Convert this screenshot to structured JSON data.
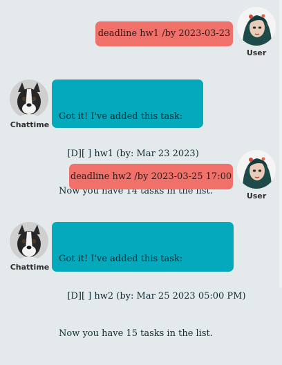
{
  "messages": [
    {
      "sender": "user",
      "name": "User",
      "text": "deadline hw1 /by 2023-03-23"
    },
    {
      "sender": "bot",
      "name": "Chattime",
      "lines": [
        "Got it! I've added this task:",
        "   [D][ ] hw1 (by: Mar 23 2023)",
        "Now you have 14 tasks in the list."
      ]
    },
    {
      "sender": "user",
      "name": "User",
      "text": "deadline hw2 /by 2023-03-25 17:00"
    },
    {
      "sender": "bot",
      "name": "Chattime",
      "lines": [
        "Got it! I've added this task:",
        "   [D][ ] hw2 (by: Mar 25 2023 05:00 PM)",
        "Now you have 15 tasks in the list."
      ]
    }
  ],
  "icons": {
    "user_avatar": "user-avatar-portrait",
    "bot_avatar": "boston-terrier-avatar"
  },
  "colors": {
    "background": "#e4eaec",
    "user_bubble": "#f0716a",
    "bot_bubble": "#04a9bc"
  }
}
